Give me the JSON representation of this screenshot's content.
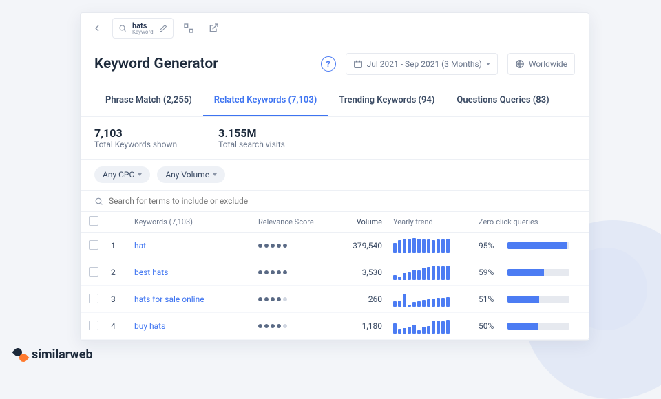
{
  "topbar": {
    "keyword": "hats",
    "keyword_sub": "Keyword"
  },
  "header": {
    "title": "Keyword Generator",
    "date_range": "Jul 2021 - Sep 2021 (3 Months)",
    "geo": "Worldwide"
  },
  "tabs": [
    {
      "label": "Phrase Match (2,255)",
      "active": false
    },
    {
      "label": "Related Keywords (7,103)",
      "active": true
    },
    {
      "label": "Trending Keywords (94)",
      "active": false
    },
    {
      "label": "Questions Queries (83)",
      "active": false
    }
  ],
  "stats": {
    "total_keywords": "7,103",
    "total_keywords_label": "Total Keywords shown",
    "total_visits": "3.155M",
    "total_visits_label": "Total search visits"
  },
  "filters": {
    "cpc": "Any CPC",
    "volume": "Any Volume"
  },
  "table": {
    "search_placeholder": "Search for terms to include or exclude",
    "headers": {
      "keywords": "Keywords (7,103)",
      "relevance": "Relevance Score",
      "volume": "Volume",
      "trend": "Yearly trend",
      "zero": "Zero-click queries"
    },
    "rows": [
      {
        "rank": "1",
        "keyword": "hat",
        "relevance": 5,
        "volume": "379,540",
        "trend": [
          70,
          85,
          90,
          95,
          100,
          95,
          92,
          90,
          88,
          90,
          92,
          95
        ],
        "zero": "95%",
        "zero_w": 95
      },
      {
        "rank": "2",
        "keyword": "best hats",
        "relevance": 5,
        "volume": "3,530",
        "trend": [
          30,
          25,
          45,
          50,
          70,
          65,
          80,
          85,
          95,
          90,
          92,
          95
        ],
        "zero": "59%",
        "zero_w": 59
      },
      {
        "rank": "3",
        "keyword": "hats for sale online",
        "relevance": 4,
        "volume": "260",
        "trend": [
          35,
          40,
          80,
          15,
          30,
          35,
          45,
          50,
          55,
          60,
          58,
          62
        ],
        "zero": "51%",
        "zero_w": 51
      },
      {
        "rank": "4",
        "keyword": "buy hats",
        "relevance": 4,
        "volume": "1,180",
        "trend": [
          70,
          30,
          35,
          45,
          60,
          25,
          45,
          50,
          85,
          88,
          80,
          90
        ],
        "zero": "50%",
        "zero_w": 50
      }
    ]
  },
  "brand": "similarweb"
}
